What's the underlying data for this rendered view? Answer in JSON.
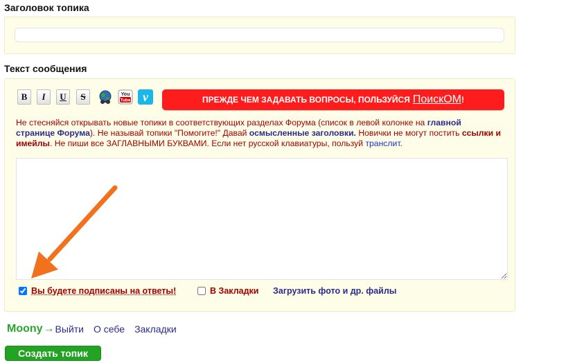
{
  "topic_section": {
    "label": "Заголовок топика",
    "input_value": "",
    "input_placeholder": ""
  },
  "message_section": {
    "label": "Текст сообщения",
    "toolbar": {
      "bold": "B",
      "italic": "I",
      "underline": "U",
      "strike": "S",
      "youtube_top": "You",
      "youtube_bottom": "Tube",
      "vimeo": "v"
    },
    "banner": {
      "text": "ПРЕЖДЕ ЧЕМ ЗАДАВАТЬ ВОПРОСЫ, ПОЛЬЗУЙСЯ",
      "link": "ПоискОМ",
      "end": "!"
    },
    "rules": {
      "p1": "Не стесняйся открывать новые топики в соответствующих разделах Форума (список в левой колонке на ",
      "p2": "главной странице Форума",
      "p3": "). Не называй топики \"Помогите!\" Давай ",
      "p4": "осмысленные заголовки.",
      "p5": " Новички не могут постить ",
      "p6": "ссылки и имейлы",
      "p7": ". Не пиши все ЗАГЛАВНЫМИ БУКВАМИ. Если нет русской клавиатуры, пользуй ",
      "p8": "транслит",
      "p9": "."
    },
    "textarea_value": "",
    "options": {
      "subscribe_label": "Вы будете подписаны на ответы!",
      "subscribe_checked": true,
      "bookmark_label": "В Закладки",
      "bookmark_checked": false,
      "upload_label": "Загрузить фото и др. файлы"
    }
  },
  "user_bar": {
    "username": "Moony",
    "arrow": "→",
    "logout": "Выйти",
    "about": "О себе",
    "bookmarks": "Закладки"
  },
  "submit": {
    "label": "Создать топик"
  },
  "colors": {
    "panel_bg": "#fdfde8",
    "banner_red": "#ff1c1c",
    "warning_text": "#a50000",
    "link_blue": "#2b2b8c",
    "green": "#23a323",
    "annotation_arrow": "#f2711c"
  },
  "icons": {
    "earth": "earth-icon",
    "youtube": "youtube-icon",
    "vimeo": "vimeo-icon",
    "annotation": "annotation-arrow-icon"
  }
}
